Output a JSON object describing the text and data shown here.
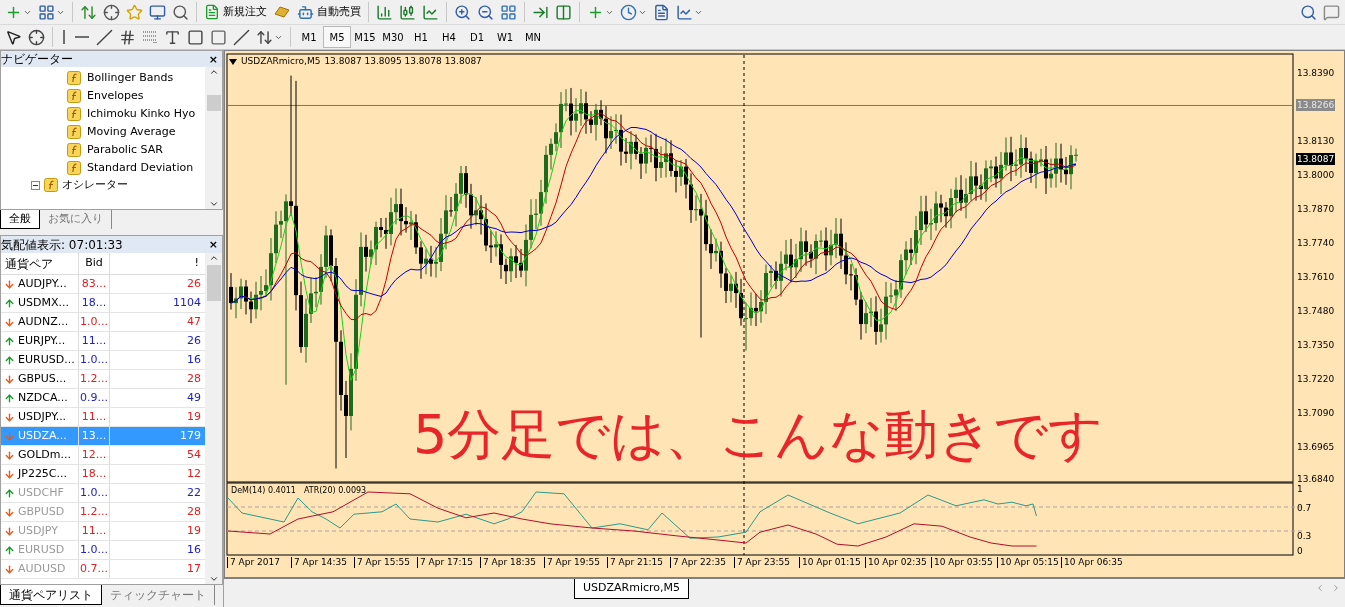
{
  "toolbar": {
    "order_button": "新規注文",
    "autotrade_button": "自動売買"
  },
  "timeframes": [
    {
      "label": "M1",
      "selected": false
    },
    {
      "label": "M5",
      "selected": true
    },
    {
      "label": "M15",
      "selected": false
    },
    {
      "label": "M30",
      "selected": false
    },
    {
      "label": "H1",
      "selected": false
    },
    {
      "label": "H4",
      "selected": false
    },
    {
      "label": "D1",
      "selected": false
    },
    {
      "label": "W1",
      "selected": false
    },
    {
      "label": "MN",
      "selected": false
    }
  ],
  "navigator": {
    "title": "ナビゲーター",
    "close": "×",
    "items": [
      "Bollinger Bands",
      "Envelopes",
      "Ichimoku Kinko Hyo",
      "Moving Average",
      "Parabolic SAR",
      "Standard Deviation"
    ],
    "group": {
      "label": "オシレーター",
      "expanded": true
    },
    "tabs": [
      {
        "label": "全般",
        "selected": true
      },
      {
        "label": "お気に入り",
        "selected": false
      }
    ]
  },
  "market_watch": {
    "title": "気配値表示: 07:01:33",
    "close": "×",
    "columns": [
      "通貨ペア",
      "Bid",
      "!"
    ],
    "rows": [
      {
        "symbol": "AUDJPY...",
        "bid": "83...",
        "spread": "26",
        "rising": false,
        "selected": false,
        "dimmed": false
      },
      {
        "symbol": "USDMX...",
        "bid": "18...",
        "spread": "1104",
        "rising": true,
        "selected": false,
        "dimmed": false
      },
      {
        "symbol": "AUDNZ...",
        "bid": "1.0...",
        "spread": "47",
        "rising": false,
        "selected": false,
        "dimmed": false
      },
      {
        "symbol": "EURJPY...",
        "bid": "11...",
        "spread": "26",
        "rising": true,
        "selected": false,
        "dimmed": false
      },
      {
        "symbol": "EURUSD...",
        "bid": "1.0...",
        "spread": "16",
        "rising": true,
        "selected": false,
        "dimmed": false
      },
      {
        "symbol": "GBPUS...",
        "bid": "1.2...",
        "spread": "28",
        "rising": false,
        "selected": false,
        "dimmed": false
      },
      {
        "symbol": "NZDCA...",
        "bid": "0.9...",
        "spread": "49",
        "rising": true,
        "selected": false,
        "dimmed": false
      },
      {
        "symbol": "USDJPY...",
        "bid": "11...",
        "spread": "19",
        "rising": false,
        "selected": false,
        "dimmed": false
      },
      {
        "symbol": "USDZA...",
        "bid": "13...",
        "spread": "179",
        "rising": false,
        "selected": true,
        "dimmed": false
      },
      {
        "symbol": "GOLDm...",
        "bid": "12...",
        "spread": "54",
        "rising": false,
        "selected": false,
        "dimmed": false
      },
      {
        "symbol": "JP225C...",
        "bid": "18...",
        "spread": "12",
        "rising": false,
        "selected": false,
        "dimmed": false
      },
      {
        "symbol": "USDCHF",
        "bid": "1.0...",
        "spread": "22",
        "rising": true,
        "selected": false,
        "dimmed": true
      },
      {
        "symbol": "GBPUSD",
        "bid": "1.2...",
        "spread": "28",
        "rising": false,
        "selected": false,
        "dimmed": true
      },
      {
        "symbol": "USDJPY",
        "bid": "11...",
        "spread": "19",
        "rising": false,
        "selected": false,
        "dimmed": true
      },
      {
        "symbol": "EURUSD",
        "bid": "1.0...",
        "spread": "16",
        "rising": true,
        "selected": false,
        "dimmed": true
      },
      {
        "symbol": "AUDUSD",
        "bid": "0.7...",
        "spread": "17",
        "rising": false,
        "selected": false,
        "dimmed": true
      }
    ],
    "tabs": [
      {
        "label": "通貨ペアリスト",
        "selected": true
      },
      {
        "label": "ティックチャート",
        "selected": false
      }
    ]
  },
  "chart": {
    "symbol": "USDZARmicro,M5",
    "ohlc": "13.8087 13.8095 13.8078 13.8087",
    "price_axis": [
      {
        "label": "13.8390",
        "kind": "tick"
      },
      {
        "label": "13.8266",
        "kind": "line"
      },
      {
        "label": "13.8130",
        "kind": "tick"
      },
      {
        "label": "13.8087",
        "kind": "current"
      },
      {
        "label": "13.8000",
        "kind": "tick"
      },
      {
        "label": "13.7870",
        "kind": "tick"
      },
      {
        "label": "13.7740",
        "kind": "tick"
      },
      {
        "label": "13.7610",
        "kind": "tick"
      },
      {
        "label": "13.7480",
        "kind": "tick"
      },
      {
        "label": "13.7350",
        "kind": "tick"
      },
      {
        "label": "13.7220",
        "kind": "tick"
      },
      {
        "label": "13.7090",
        "kind": "tick"
      },
      {
        "label": "13.6965",
        "kind": "tick"
      },
      {
        "label": "13.6840",
        "kind": "tick"
      }
    ],
    "caption": "5分足では、こんな動きです",
    "indicator": {
      "dem": "DeM(14) 0.4011",
      "atr": "ATR(20) 0.0093",
      "levels": [
        "1",
        "0.7",
        "0.3",
        "0"
      ]
    },
    "time_axis": [
      "7 Apr 2017",
      "7 Apr 14:35",
      "7 Apr 15:55",
      "7 Apr 17:15",
      "7 Apr 18:35",
      "7 Apr 19:55",
      "7 Apr 21:15",
      "7 Apr 22:35",
      "7 Apr 23:55",
      "10 Apr 01:15",
      "10 Apr 02:35",
      "10 Apr 03:55",
      "10 Apr 05:15",
      "10 Apr 06:35"
    ]
  },
  "chart_tabs": [
    {
      "label": "USDZARmicro,M5",
      "selected": true
    }
  ]
}
